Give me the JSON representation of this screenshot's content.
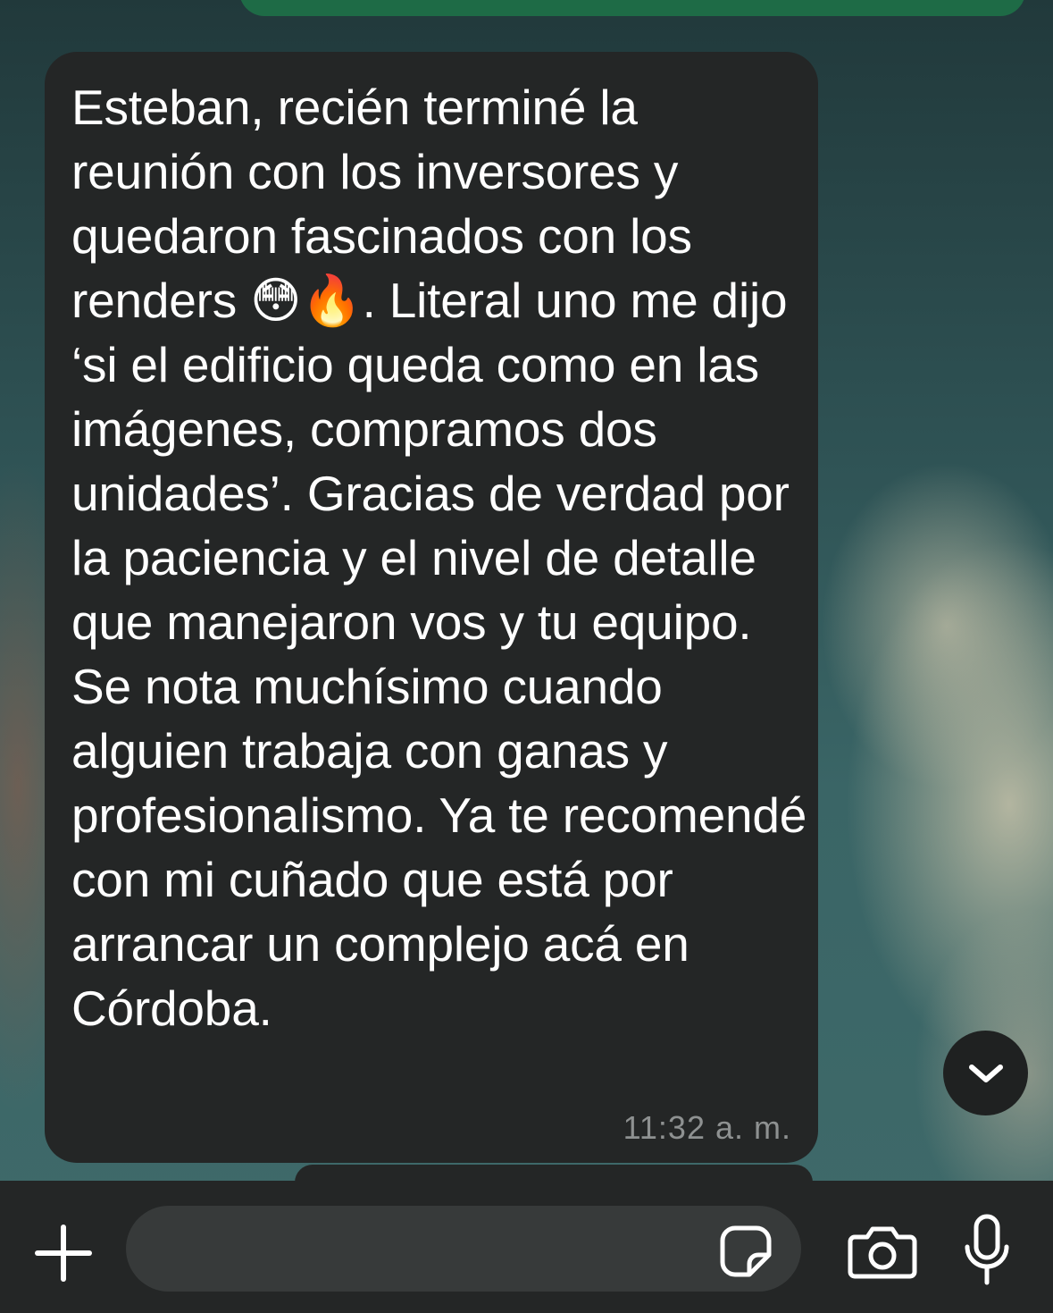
{
  "conversation": {
    "message": {
      "text": "Esteban, recién terminé la reunión con los inversores y quedaron fascinados con los renders 😳🔥. Literal uno me dijo ‘si el edificio queda como en las imágenes, compramos dos unidades’. Gracias de verdad por la paciencia y el nivel de detalle que manejaron vos y tu equipo. Se nota muchísimo cuando alguien trabaja con ganas y profesionalismo. Ya te recomendé con mi cuñado que está por arrancar un complejo acá en Córdoba.",
      "time": "11:32 a. m."
    }
  },
  "input_bar": {
    "message_value": "",
    "plus_icon": "plus-icon",
    "sticker_icon": "sticker-icon",
    "camera_icon": "camera-icon",
    "mic_icon": "microphone-icon"
  },
  "scroll_down_icon": "chevron-down-icon",
  "colors": {
    "incoming_bubble": "#242626",
    "outgoing_bubble": "#1e6b46",
    "input_bar": "#242626",
    "timestamp": "#8e9191"
  }
}
